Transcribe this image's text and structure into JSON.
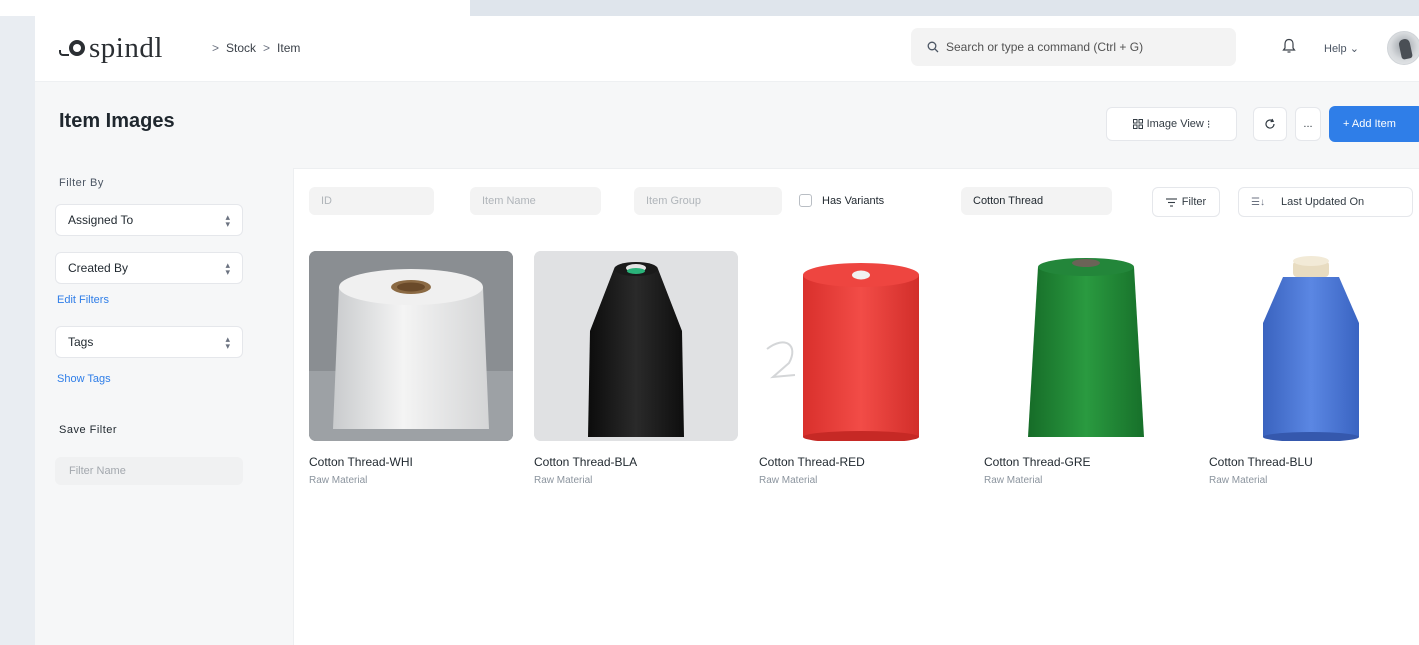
{
  "navbar": {
    "logo_text": "spindl",
    "breadcrumbs": [
      "Stock",
      "Item"
    ],
    "breadcrumb_sep": ">",
    "search_placeholder": "Search or type a command (Ctrl + G)",
    "help_label": "Help"
  },
  "page": {
    "title": "Item Images",
    "view_label": "Image View",
    "add_label": "+ Add Item",
    "more_label": "..."
  },
  "sidebar": {
    "filter_by_label": "Filter By",
    "assigned_to": "Assigned To",
    "created_by": "Created By",
    "edit_filters": "Edit Filters",
    "tags": "Tags",
    "show_tags": "Show Tags",
    "save_filter_label": "Save Filter",
    "filter_name_placeholder": "Filter Name"
  },
  "filters": {
    "id_placeholder": "ID",
    "item_name_placeholder": "Item Name",
    "item_group_placeholder": "Item Group",
    "has_variants_label": "Has Variants",
    "has_variants_checked": false,
    "search_value": "Cotton Thread",
    "filter_label": "Filter",
    "sort_label": "Last Updated On"
  },
  "items": [
    {
      "name": "Cotton Thread-WHI",
      "group": "Raw Material",
      "color": "#ececec"
    },
    {
      "name": "Cotton Thread-BLA",
      "group": "Raw Material",
      "color": "#161616"
    },
    {
      "name": "Cotton Thread-RED",
      "group": "Raw Material",
      "color": "#e8413d"
    },
    {
      "name": "Cotton Thread-GRE",
      "group": "Raw Material",
      "color": "#1f8a36"
    },
    {
      "name": "Cotton Thread-BLU",
      "group": "Raw Material",
      "color": "#4a77d4"
    }
  ],
  "colors": {
    "accent": "#2f7ee8",
    "link": "#2f7ee8"
  }
}
